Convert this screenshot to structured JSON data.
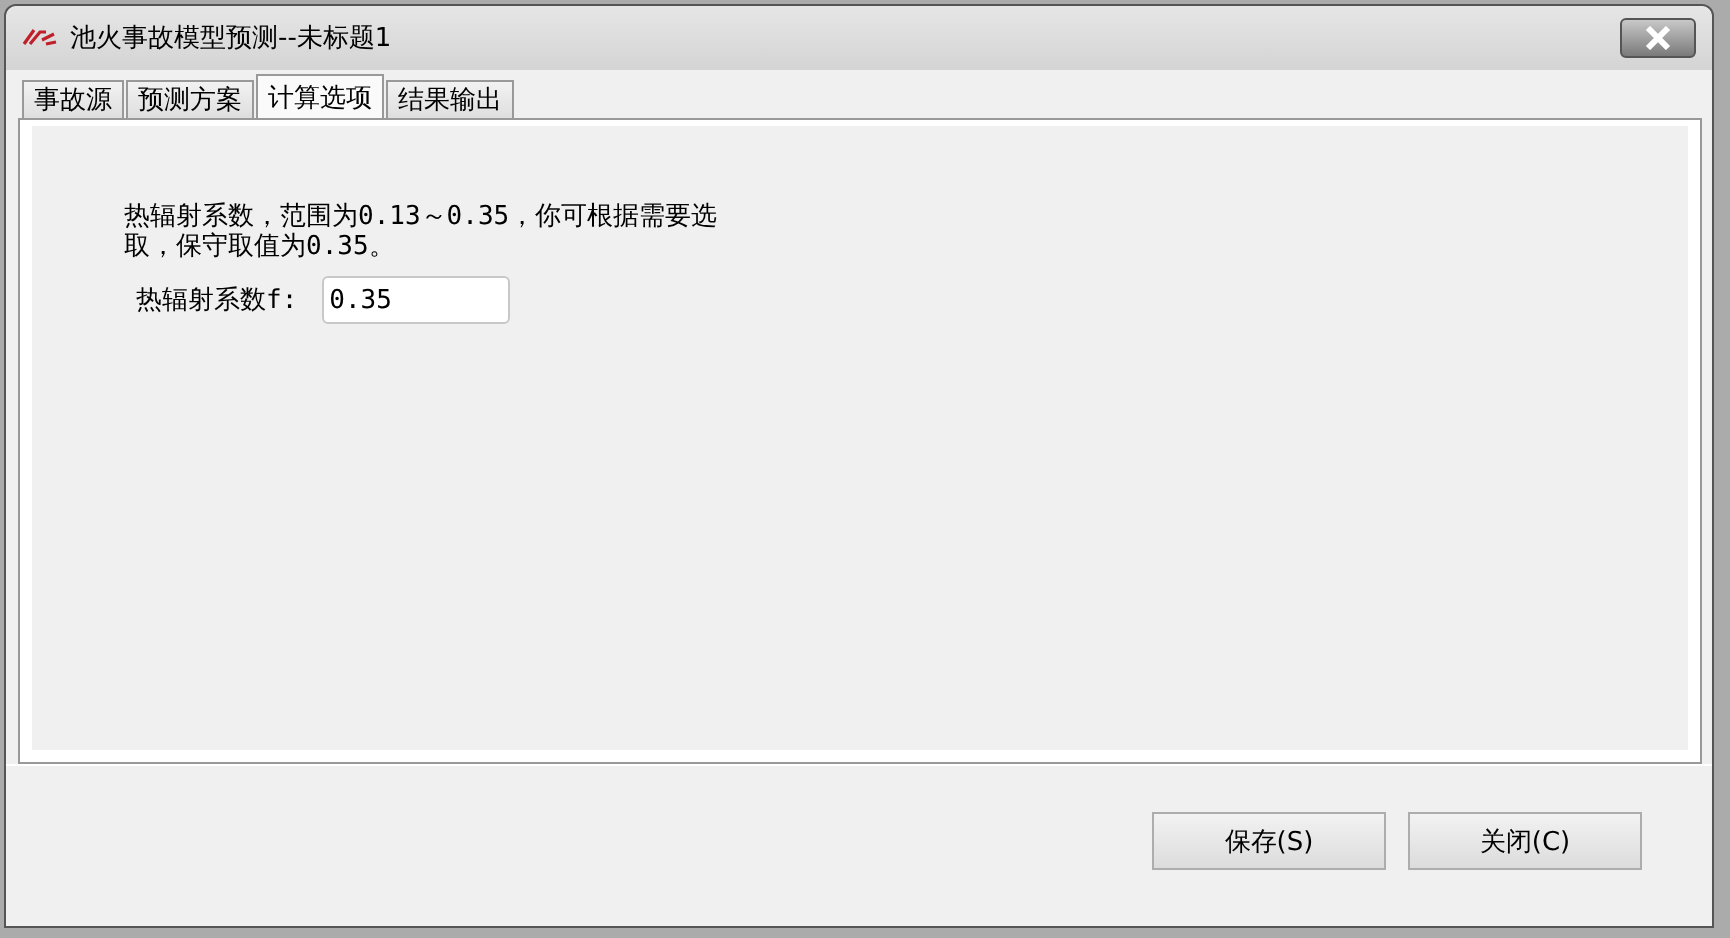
{
  "window": {
    "title": "池火事故模型预测--未标题1"
  },
  "tabs": [
    {
      "label": "事故源",
      "selected": false
    },
    {
      "label": "预测方案",
      "selected": false
    },
    {
      "label": "计算选项",
      "selected": true
    },
    {
      "label": "结果输出",
      "selected": false
    }
  ],
  "hint": "热辐射系数，范围为0.13～0.35，你可根据需要选取，保守取值为0.35。",
  "field": {
    "label": "热辐射系数f:",
    "value": "0.35"
  },
  "buttons": [
    "保存(S)",
    "关闭(C)"
  ]
}
